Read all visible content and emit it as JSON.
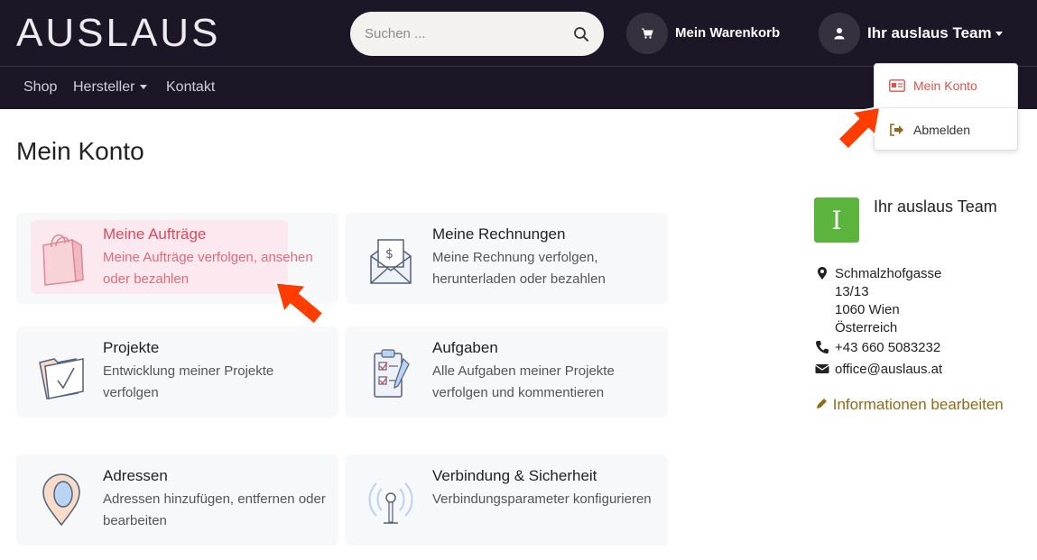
{
  "header": {
    "logo": "AUSLAUS",
    "search_placeholder": "Suchen ...",
    "cart_label": "Mein Warenkorb",
    "user_label": "Ihr auslaus Team"
  },
  "nav": {
    "items": [
      {
        "label": "Shop"
      },
      {
        "label": "Hersteller"
      },
      {
        "label": "Kontakt"
      }
    ]
  },
  "user_menu": {
    "items": [
      {
        "label": "Mein Konto"
      },
      {
        "label": "Abmelden"
      }
    ]
  },
  "page": {
    "title": "Mein Konto"
  },
  "cards": [
    {
      "title": "Meine Aufträge",
      "desc": "Meine Aufträge verfolgen, ansehen oder bezahlen"
    },
    {
      "title": "Meine Rechnungen",
      "desc": "Meine Rechnung verfolgen, herunterladen oder bezahlen"
    },
    {
      "title": "Projekte",
      "desc": "Entwicklung meiner Projekte verfolgen"
    },
    {
      "title": "Aufgaben",
      "desc": "Alle Aufgaben meiner Projekte verfolgen und kommentieren"
    },
    {
      "title": "Adressen",
      "desc": "Adressen hinzufügen, entfernen oder bearbeiten"
    },
    {
      "title": "Verbindung & Sicherheit",
      "desc": "Verbindungsparameter konfigurieren"
    }
  ],
  "profile": {
    "avatar_letter": "I",
    "name": "Ihr auslaus Team",
    "street": "Schmalzhofgasse",
    "street2": "13/13",
    "city": "1060 Wien",
    "country": "Österreich",
    "phone": "+43 660 5083232",
    "email": "office@auslaus.at",
    "edit_label": "Informationen bearbeiten"
  },
  "colors": {
    "header_bg": "#1c1626",
    "accent_red": "#d84a5e",
    "avatar_green": "#5bb53d",
    "edit_link": "#8e6a1a",
    "arrow": "#ff3d00"
  }
}
